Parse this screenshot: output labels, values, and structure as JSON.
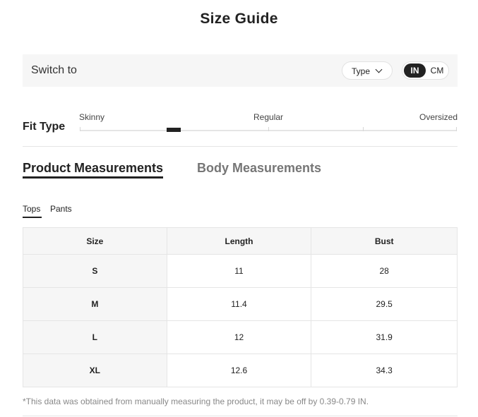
{
  "title": "Size Guide",
  "switch_bar": {
    "label": "Switch to",
    "type_select": "Type",
    "units": [
      "IN",
      "CM"
    ],
    "active_unit": "IN"
  },
  "fit_type": {
    "label": "Fit Type",
    "levels": [
      "Skinny",
      "Regular",
      "Oversized"
    ],
    "marker_fraction": 0.25
  },
  "tabs": {
    "product": "Product Measurements",
    "body": "Body Measurements",
    "active": "Product Measurements"
  },
  "subtabs": {
    "tops": "Tops",
    "pants": "Pants",
    "active": "Tops"
  },
  "table": {
    "headers": [
      "Size",
      "Length",
      "Bust"
    ],
    "rows": [
      [
        "S",
        "11",
        "28"
      ],
      [
        "M",
        "11.4",
        "29.5"
      ],
      [
        "L",
        "12",
        "31.9"
      ],
      [
        "XL",
        "12.6",
        "34.3"
      ]
    ]
  },
  "footnote": "*This data was obtained from manually measuring the product, it may be off by 0.39-0.79 IN.",
  "colors": {
    "text": "#222222",
    "muted_tab": "#767676",
    "panel_bg": "#f6f6f6",
    "border": "#e5e5e5",
    "footnote": "#888888"
  }
}
